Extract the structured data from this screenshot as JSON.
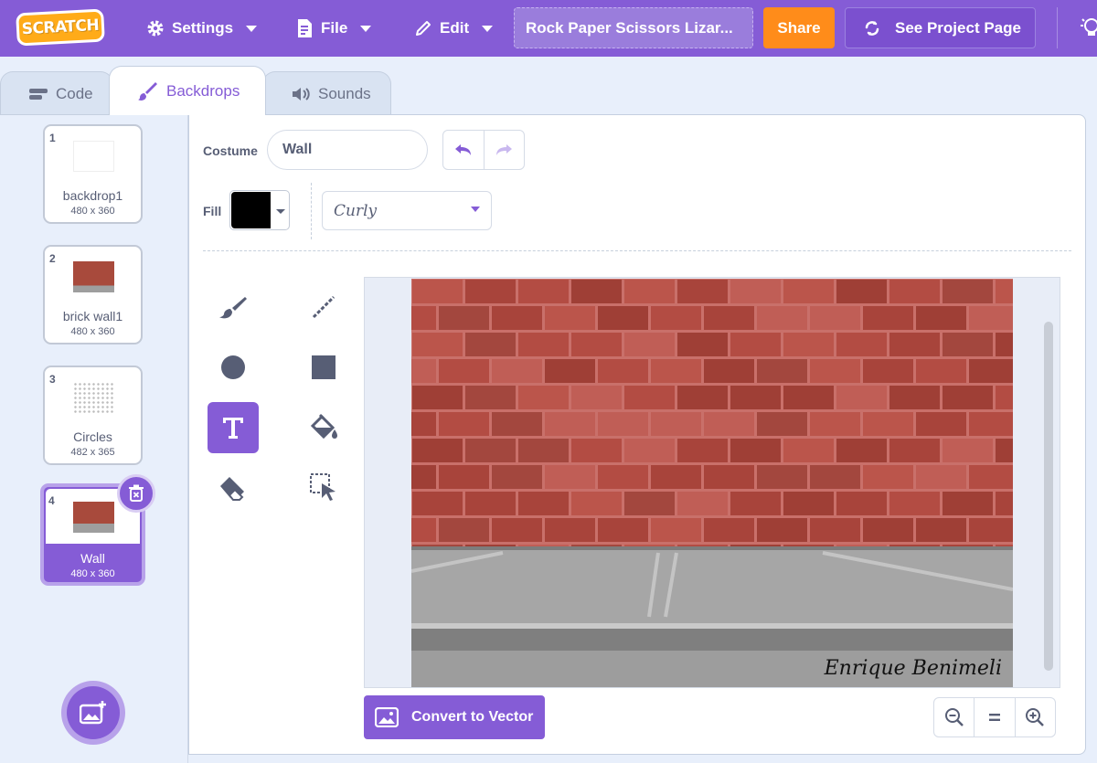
{
  "menubar": {
    "logo": "SCRATCH",
    "settings_label": "Settings",
    "file_label": "File",
    "edit_label": "Edit",
    "project_title": "Rock Paper Scissors Lizar...",
    "share_label": "Share",
    "see_project_label": "See Project Page",
    "accent_color": "#855cd6"
  },
  "tabs": [
    {
      "label": "Code",
      "icon": "code-blocks-icon"
    },
    {
      "label": "Backdrops",
      "icon": "brush-icon",
      "active": true
    },
    {
      "label": "Sounds",
      "icon": "speaker-icon"
    }
  ],
  "backdrops": [
    {
      "number": "1",
      "name": "backdrop1",
      "size": "480 x 360"
    },
    {
      "number": "2",
      "name": "brick wall1",
      "size": "480 x 360"
    },
    {
      "number": "3",
      "name": "Circles",
      "size": "482 x 365"
    },
    {
      "number": "4",
      "name": "Wall",
      "size": "480 x 360",
      "selected": true
    }
  ],
  "editor": {
    "costume_label": "Costume",
    "costume_name": "Wall",
    "fill_label": "Fill",
    "fill_color": "#000000",
    "font": "Curly",
    "active_tool": "text-tool",
    "canvas_text": "Enrique Benimeli",
    "convert_label": "Convert to Vector"
  }
}
